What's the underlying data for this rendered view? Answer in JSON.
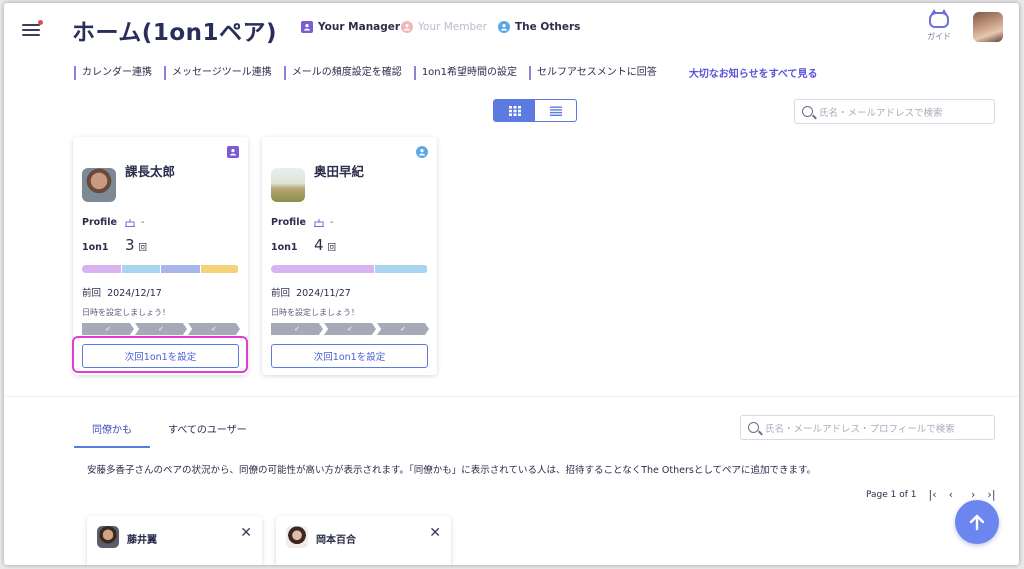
{
  "header": {
    "title": "ホーム(1on1ペア)",
    "legend": [
      {
        "label": "Your Manager",
        "color": "#7b5bd6",
        "icon": "manager-icon"
      },
      {
        "label": "Your Member",
        "color": "#f2b6b6",
        "icon": "member-icon"
      },
      {
        "label": "The Others",
        "color": "#5aa9e6",
        "icon": "others-icon"
      }
    ],
    "guide_label": "ガイド"
  },
  "links": {
    "items": [
      "カレンダー連携",
      "メッセージツール連携",
      "メールの頻度設定を確認",
      "1on1希望時間の設定",
      "セルフアセスメントに回答"
    ],
    "all_notices": "大切なお知らせをすべて見る"
  },
  "search": {
    "pairs_placeholder": "氏名・メールアドレスで検索",
    "users_placeholder": "氏名・メールアドレス・プロフィールで検索"
  },
  "cards": [
    {
      "name": "課長太郎",
      "role_icon": "manager-icon",
      "role_color": "#7b5bd6",
      "profile_label": "Profile",
      "profile_value": "-",
      "oneonone_label": "1on1",
      "count": "3",
      "count_unit": "回",
      "bar_colors": [
        "#d7b3f2",
        "#a9d4ef",
        "#a9b6ea",
        "#f5d27a"
      ],
      "last_label": "前回",
      "last_date": "2024/12/17",
      "hint": "日時を設定しましょう！",
      "button": "次回1on1を設定"
    },
    {
      "name": "奥田早紀",
      "role_icon": "others-icon",
      "role_color": "#5aa9e6",
      "profile_label": "Profile",
      "profile_value": "-",
      "oneonone_label": "1on1",
      "count": "4",
      "count_unit": "回",
      "bar_colors": [
        "#d7b3f2",
        "#a9d4ef"
      ],
      "last_label": "前回",
      "last_date": "2024/11/27",
      "hint": "日時を設定しましょう！",
      "button": "次回1on1を設定"
    }
  ],
  "tabs": [
    {
      "label": "同僚かも",
      "active": true
    },
    {
      "label": "すべてのユーザー",
      "active": false
    }
  ],
  "description": "安藤多香子さんのペアの状況から、同僚の可能性が高い方が表示されます。「同僚かも」に表示されている人は、招待することなくThe Othersとしてペアに追加できます。",
  "pager": {
    "text": "Page 1 of 1"
  },
  "suggested_users": [
    {
      "name": "藤井翼"
    },
    {
      "name": "岡本百合"
    }
  ]
}
